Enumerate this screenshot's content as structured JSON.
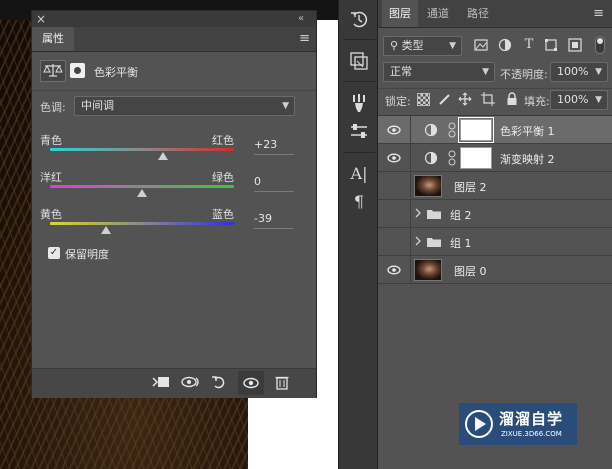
{
  "properties_panel": {
    "close_glyph": "×",
    "collapse_glyph": "«",
    "menu_glyph": "≡",
    "tab_label": "属性",
    "adjustment_title": "色彩平衡",
    "tone_label": "色调:",
    "tone_value": "中间调",
    "sliders": [
      {
        "left": "青色",
        "right": "红色",
        "value_text": "+23",
        "level": 23,
        "range": [
          -100,
          100
        ],
        "gradient": [
          "#25d6d6",
          "#d22c2c"
        ]
      },
      {
        "left": "洋红",
        "right": "绿色",
        "value_text": "0",
        "level": 0,
        "range": [
          -100,
          100
        ],
        "gradient": [
          "#e03ae0",
          "#38c938"
        ]
      },
      {
        "left": "黄色",
        "right": "蓝色",
        "value_text": "-39",
        "level": -39,
        "range": [
          -100,
          100
        ],
        "gradient": [
          "#d8d82a",
          "#3030e0"
        ]
      }
    ],
    "preserve_luminosity_label": "保留明度",
    "preserve_luminosity_checked": true,
    "footer_icons": [
      "clip-to-layer-icon",
      "view-previous-state-icon",
      "reset-icon",
      "visibility-icon",
      "delete-icon"
    ]
  },
  "toolstrip": {
    "icons": [
      "history-icon",
      "layer-comps-icon",
      "brushes-icon",
      "adjustments-icon",
      "character-icon",
      "paragraph-icon"
    ],
    "glyphs": {
      "character": "A|",
      "paragraph": "¶"
    }
  },
  "layers_panel": {
    "tabs": [
      {
        "label": "图层",
        "active": true
      },
      {
        "label": "通道",
        "active": false
      },
      {
        "label": "路径",
        "active": false
      }
    ],
    "menu_glyph": "≡",
    "filter_label": "类型",
    "blend_mode": "正常",
    "opacity_label": "不透明度:",
    "opacity_value": "100%",
    "lock_label": "锁定:",
    "fill_label": "填充:",
    "fill_value": "100%",
    "layers": [
      {
        "name": "色彩平衡 1",
        "kind": "adjustment",
        "selected": true,
        "visible": true
      },
      {
        "name": "渐变映射 2",
        "kind": "adjustment",
        "selected": false,
        "visible": true
      },
      {
        "name": "图层 2",
        "kind": "photo",
        "selected": false,
        "visible": false
      },
      {
        "name": "组 2",
        "kind": "group",
        "selected": false,
        "visible": false
      },
      {
        "name": "组 1",
        "kind": "group",
        "selected": false,
        "visible": false
      },
      {
        "name": "图层 0",
        "kind": "photo",
        "selected": false,
        "visible": true
      }
    ]
  },
  "watermark": {
    "title": "溜溜自学",
    "url": "ZIXUE.3D66.COM",
    "color": "#2a5a9a"
  }
}
